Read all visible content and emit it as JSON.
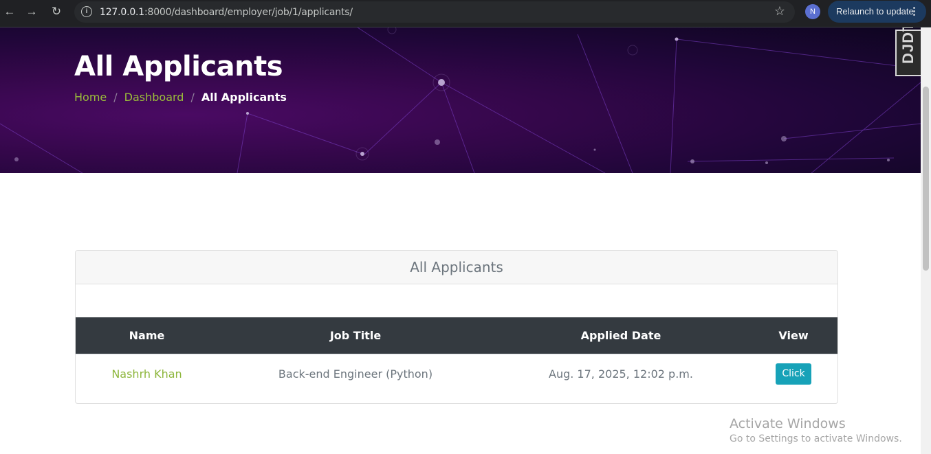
{
  "browser": {
    "url_host": "127.0.0.1",
    "url_rest": ":8000/dashboard/employer/job/1/applicants/",
    "profile_initial": "N",
    "relaunch_label": "Relaunch to update"
  },
  "hero": {
    "title": "All Applicants",
    "breadcrumb": [
      "Home",
      "Dashboard",
      "All Applicants"
    ]
  },
  "debug_toolbar": {
    "label": "DJDT"
  },
  "card": {
    "title": "All Applicants",
    "columns": [
      "Name",
      "Job Title",
      "Applied Date",
      "View"
    ],
    "rows": [
      {
        "name": "Nashrh Khan",
        "job_title": "Back-end Engineer (Python)",
        "applied_date": "Aug. 17, 2025, 12:02 p.m.",
        "view_label": "Click"
      }
    ]
  },
  "watermark": {
    "line1": "Activate Windows",
    "line2": "Go to Settings to activate Windows."
  },
  "colors": {
    "accent_link": "#8db63c",
    "button": "#17a2b8",
    "table_header": "#343a40",
    "hero_bg": "#34074a"
  }
}
